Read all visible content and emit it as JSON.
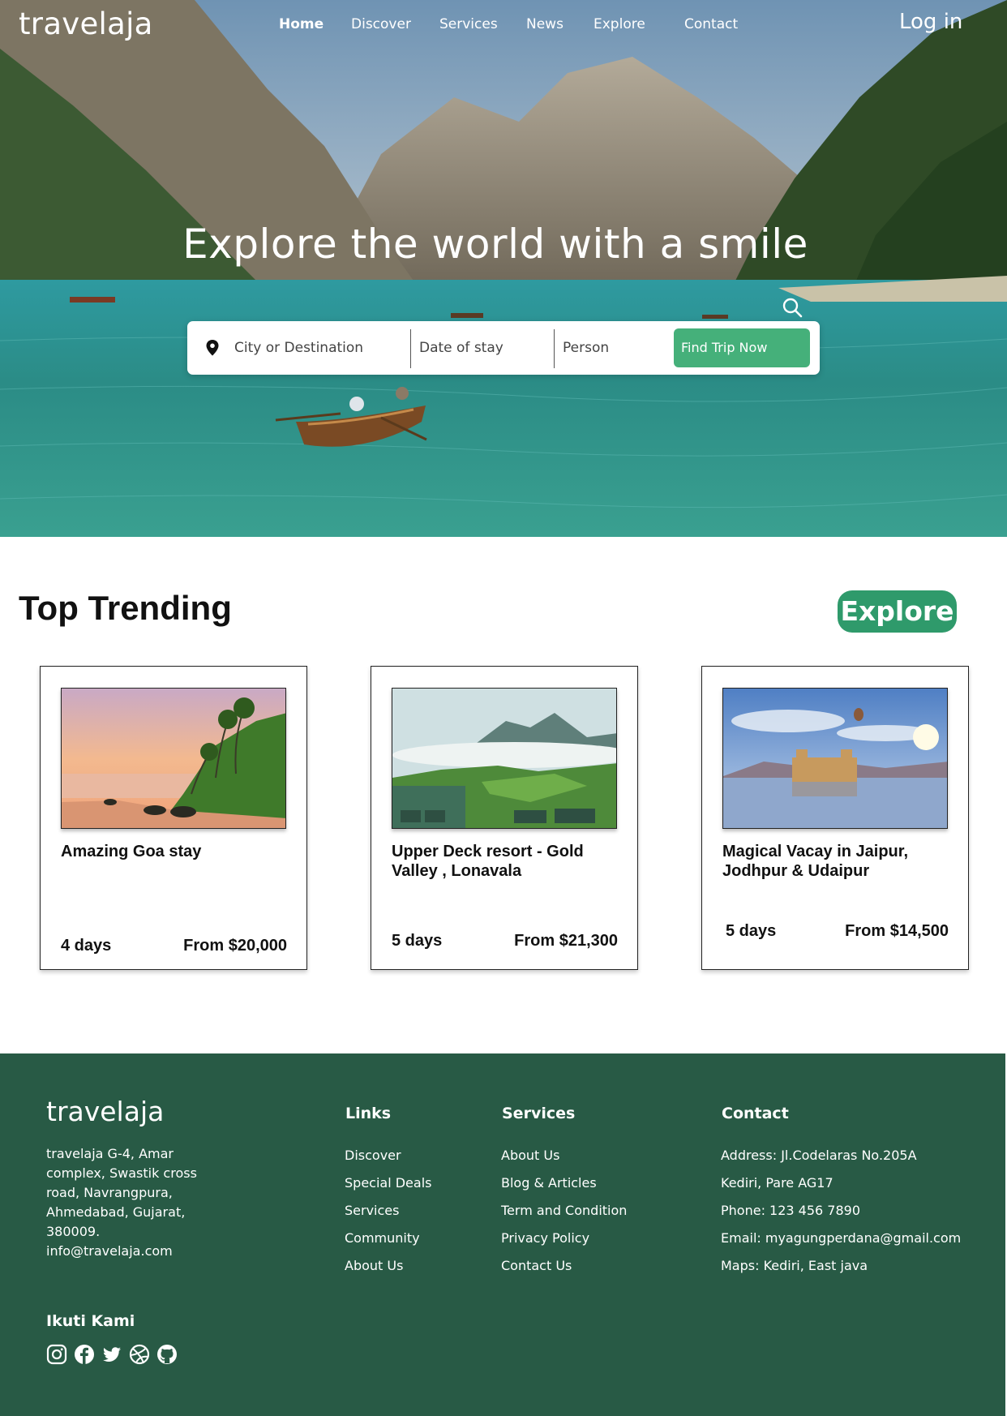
{
  "header": {
    "brand": "travelaja",
    "nav": [
      "Home",
      "Discover",
      "Services",
      "News",
      "Explore",
      "Contact"
    ],
    "active_nav": "Home",
    "login": "Log in"
  },
  "hero": {
    "title": "Explore the world with a smile",
    "search_icon": "search-icon",
    "search": {
      "destination_placeholder": "City or Destination",
      "date_placeholder": "Date of stay",
      "person_placeholder": "Person",
      "button": "Find Trip Now",
      "pin_icon": "map-pin-icon"
    }
  },
  "trending": {
    "title": "Top Trending",
    "explore_button": "Explore",
    "cards": [
      {
        "name": "Amazing Goa stay",
        "days": "4 days",
        "price": "From $20,000",
        "image": "tropical beach with palm trees at sunset"
      },
      {
        "name": "Upper Deck resort - Gold Valley , Lonavala",
        "days": "5 days",
        "price": "From $21,300",
        "image": "hill resort above clouds"
      },
      {
        "name": "Magical Vacay in Jaipur, Jodhpur & Udaipur",
        "days": "5 days",
        "price": "From $14,500",
        "image": "water palace on a lake with hot air balloon"
      }
    ]
  },
  "footer": {
    "brand": "travelaja",
    "address": "travelaja G-4, Amar complex, Swastik cross road, Navrangpura, Ahmedabad, Gujarat, 380009. info@travelaja.com",
    "links_title": "Links",
    "links": [
      "Discover",
      "Special Deals",
      "Services",
      "Community",
      "About Us"
    ],
    "services_title": "Services",
    "services": [
      "About Us",
      "Blog & Articles",
      "Term and Condition",
      "Privacy Policy",
      "Contact Us"
    ],
    "contact_title": "Contact",
    "contact": [
      "Address: Jl.Codelaras No.205A",
      "Kediri, Pare AG17",
      "Phone: 123 456 7890",
      "Email: myagungperdana@gmail.com",
      "Maps: Kediri, East java"
    ],
    "follow_title": "Ikuti Kami",
    "socials": [
      "instagram-icon",
      "facebook-icon",
      "twitter-icon",
      "dribbble-icon",
      "github-icon"
    ]
  },
  "colors": {
    "accent_green": "#45b07a",
    "explore_green": "#2f9a6b",
    "footer_bg": "#285a45"
  }
}
